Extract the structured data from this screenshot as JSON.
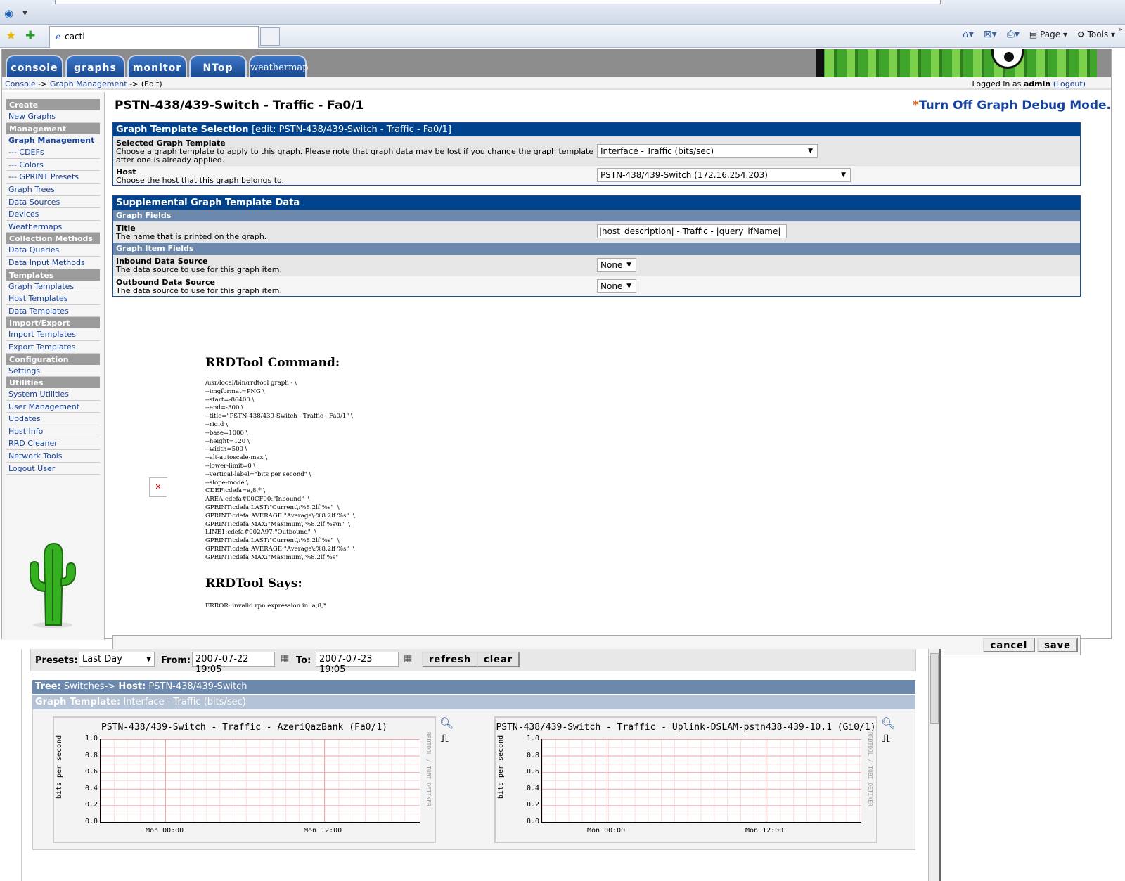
{
  "browser": {
    "tab_title": "cacti",
    "cmd": {
      "page": "Page",
      "tools": "Tools"
    }
  },
  "tabs": [
    "console",
    "graphs",
    "monitor",
    "NTop",
    "weathermap"
  ],
  "breadcrumb": {
    "console": "Console",
    "sep1": "->",
    "graph_mgmt": "Graph Management",
    "sep2": "->",
    "edit": "(Edit)"
  },
  "login": {
    "prefix": "Logged in as",
    "user": "admin",
    "logout": "(Logout)"
  },
  "sidebar": {
    "create": "Create",
    "new_graphs": "New Graphs",
    "management": "Management",
    "graph_management": "Graph Management",
    "cdefs": "--- CDEFs",
    "colors": "--- Colors",
    "gprint": "--- GPRINT Presets",
    "graph_trees": "Graph Trees",
    "data_sources": "Data Sources",
    "devices": "Devices",
    "weathermaps": "Weathermaps",
    "collection_methods": "Collection Methods",
    "data_queries": "Data Queries",
    "data_input_methods": "Data Input Methods",
    "templates": "Templates",
    "graph_templates": "Graph Templates",
    "host_templates": "Host Templates",
    "data_templates": "Data Templates",
    "import_export": "Import/Export",
    "import_templates": "Import Templates",
    "export_templates": "Export Templates",
    "configuration": "Configuration",
    "settings": "Settings",
    "utilities": "Utilities",
    "system_utilities": "System Utilities",
    "user_management": "User Management",
    "updates": "Updates",
    "host_info": "Host Info",
    "rrd_cleaner": "RRD Cleaner",
    "network_tools": "Network Tools",
    "logout_user": "Logout User"
  },
  "main": {
    "title": "PSTN-438/439-Switch - Traffic - Fa0/1",
    "debug_star": "*",
    "debug_link": "Turn Off Graph Debug Mode.",
    "template_box": {
      "head": "Graph Template Selection",
      "head_note": "[edit: PSTN-438/439-Switch - Traffic - Fa0/1]",
      "template_label": "Selected Graph Template",
      "template_desc": "Choose a graph template to apply to this graph. Please note that graph data may be lost if you change the graph template after one is already applied.",
      "template_value": "Interface - Traffic (bits/sec)",
      "host_label": "Host",
      "host_desc": "Choose the host that this graph belongs to.",
      "host_value": "PSTN-438/439-Switch (172.16.254.203)"
    },
    "supp_box": {
      "head": "Supplemental Graph Template Data",
      "graph_fields": "Graph Fields",
      "title_label": "Title",
      "title_desc": "The name that is printed on the graph.",
      "title_value": "|host_description| - Traffic - |query_ifName|",
      "item_fields": "Graph Item Fields",
      "inbound_label": "Inbound Data Source",
      "inbound_desc": "The data source to use for this graph item.",
      "inbound_value": "None",
      "outbound_label": "Outbound Data Source",
      "outbound_desc": "The data source to use for this graph item.",
      "outbound_value": "None"
    },
    "rrd_command_title": "RRDTool Command:",
    "rrd_command": "/usr/local/bin/rrdtool graph - \\\n--imgformat=PNG \\\n--start=-86400 \\\n--end=-300 \\\n--title=\"PSTN-438/439-Switch - Traffic - Fa0/1\" \\\n--rigid \\\n--base=1000 \\\n--height=120 \\\n--width=500 \\\n--alt-autoscale-max \\\n--lower-limit=0 \\\n--vertical-label=\"bits per second\" \\\n--slope-mode \\\nCDEF:cdefa=a,8,* \\\nAREA:cdefa#00CF00:\"Inbound\"  \\\nGPRINT:cdefa:LAST:\"Current\\:%8.2lf %s\"  \\\nGPRINT:cdefa:AVERAGE:\"Average\\:%8.2lf %s\"  \\\nGPRINT:cdefa:MAX:\"Maximum\\:%8.2lf %s\\n\"  \\\nLINE1:cdefa#002A97:\"Outbound\"  \\\nGPRINT:cdefa:LAST:\"Current\\:%8.2lf %s\"  \\\nGPRINT:cdefa:AVERAGE:\"Average\\:%8.2lf %s\"  \\\nGPRINT:cdefa:MAX:\"Maximum\\:%8.2lf %s\"",
    "rrd_says_title": "RRDTool Says:",
    "rrd_error": "ERROR: invalid rpn expression in: a,8,*",
    "cancel": "cancel",
    "save": "save"
  },
  "lower": {
    "presets_label": "Presets:",
    "presets_value": "Last Day",
    "from_label": "From:",
    "from_value": "2007-07-22 19:05",
    "to_label": "To:",
    "to_value": "2007-07-23 19:05",
    "refresh": "refresh",
    "clear": "clear",
    "tree_label": "Tree:",
    "tree_value": "Switches->",
    "host_label": "Host:",
    "host_value": "PSTN-438/439-Switch",
    "template_label": "Graph Template:",
    "template_value": "Interface - Traffic (bits/sec)",
    "graphs": [
      {
        "title": "PSTN-438/439-Switch - Traffic - AzeriQazBank (Fa0/1)"
      },
      {
        "title": "PSTN-438/439-Switch - Traffic - Uplink-DSLAM-pstn438-439-10.1 (Gi0/1)"
      }
    ],
    "ylabel": "bits per second",
    "side_label": "RRDTOOL / TOBI OETIKER",
    "yticks": [
      "1.0",
      "0.8",
      "0.6",
      "0.4",
      "0.2",
      "0.0"
    ],
    "xticks": [
      "Mon 00:00",
      "Mon 12:00"
    ]
  },
  "chart_data": [
    {
      "type": "area",
      "title": "PSTN-438/439-Switch - Traffic - AzeriQazBank (Fa0/1)",
      "ylabel": "bits per second",
      "ylim": [
        0,
        1.0
      ],
      "x": [
        "Mon 00:00",
        "Mon 12:00"
      ],
      "series": []
    },
    {
      "type": "area",
      "title": "PSTN-438/439-Switch - Traffic - Uplink-DSLAM-pstn438-439-10.1 (Gi0/1)",
      "ylabel": "bits per second",
      "ylim": [
        0,
        1.0
      ],
      "x": [
        "Mon 00:00",
        "Mon 12:00"
      ],
      "series": []
    }
  ]
}
